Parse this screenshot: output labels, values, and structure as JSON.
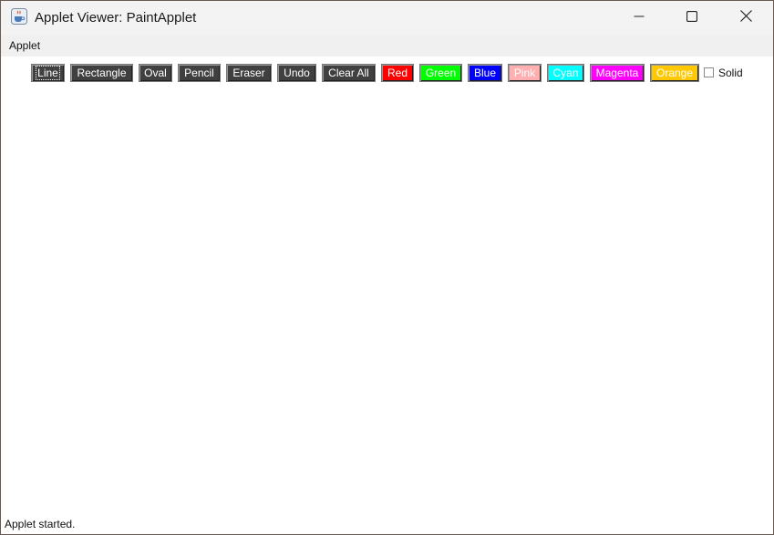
{
  "window": {
    "title": "Applet Viewer: PaintApplet",
    "icon": "java-cup-icon",
    "controls": {
      "minimize": "minimize-icon",
      "maximize": "maximize-icon",
      "close": "close-icon"
    }
  },
  "menubar": {
    "items": [
      "Applet"
    ]
  },
  "toolbar": {
    "buttons": [
      {
        "label": "Line",
        "bg": "#404040",
        "focused": true
      },
      {
        "label": "Rectangle",
        "bg": "#404040"
      },
      {
        "label": "Oval",
        "bg": "#404040"
      },
      {
        "label": "Pencil",
        "bg": "#404040"
      },
      {
        "label": "Eraser",
        "bg": "#404040"
      },
      {
        "label": "Undo",
        "bg": "#404040"
      },
      {
        "label": "Clear All",
        "bg": "#404040"
      },
      {
        "label": "Red",
        "bg": "#ff0000"
      },
      {
        "label": "Green",
        "bg": "#00ff00"
      },
      {
        "label": "Blue",
        "bg": "#0000ff"
      },
      {
        "label": "Pink",
        "bg": "#ffafaf"
      },
      {
        "label": "Cyan",
        "bg": "#00ffff"
      },
      {
        "label": "Magenta",
        "bg": "#ff00ff"
      },
      {
        "label": "Orange",
        "bg": "#ffc800"
      }
    ],
    "solid": {
      "label": "Solid",
      "checked": false
    }
  },
  "status": {
    "text": "Applet started."
  }
}
